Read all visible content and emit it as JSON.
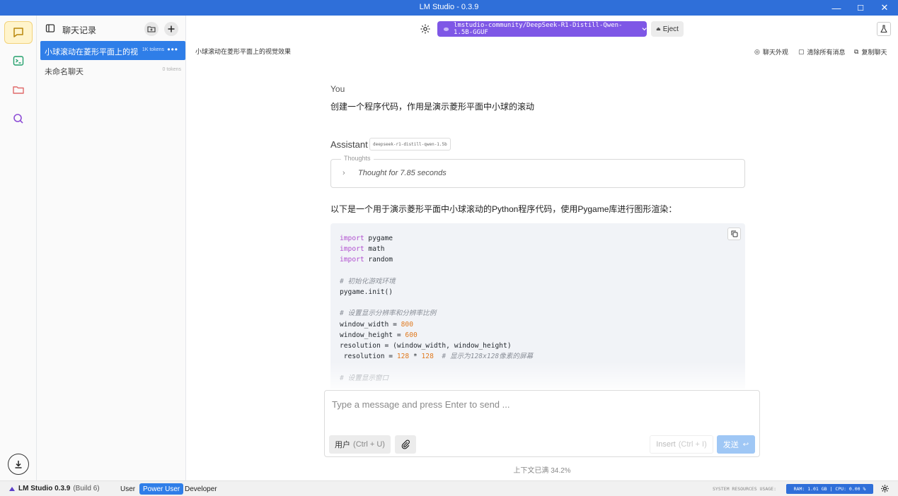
{
  "window": {
    "title": "LM Studio - 0.3.9",
    "minimize": "—",
    "maximize": "☐",
    "close": "✕"
  },
  "rail": {
    "items": [
      "chat-icon",
      "terminal-icon",
      "folder-icon",
      "search-icon"
    ],
    "download": "download-icon"
  },
  "sidebar": {
    "title": "聊天记录",
    "chats": [
      {
        "name": "小球滚动在菱形平面上的视...",
        "tokens": "1K tokens",
        "active": true
      },
      {
        "name": "未命名聊天",
        "tokens": "0 tokens",
        "active": false
      }
    ],
    "more": "•••"
  },
  "topbar": {
    "model": "lmstudio-community/DeepSeek-R1-Distill-Qwen-1.5B-GGUF",
    "eject": "Eject"
  },
  "subbar": {
    "chat_title": "小球滚动在菱形平面上的视觉效果",
    "appearance": "聊天外观",
    "clear": "清除所有消息",
    "copy": "复制聊天"
  },
  "messages": {
    "user_role": "You",
    "user_text": "创建一个程序代码，作用是演示菱形平面中小球的滚动",
    "assistant_role": "Assistant",
    "model_tag": "deepseek-r1-distill-qwen-1.5b",
    "thoughts_label": "Thoughts",
    "thoughts_text": "Thought for 7.85 seconds",
    "assistant_text": "以下是一个用于演示菱形平面中小球滚动的Python程序代码，使用Pygame库进行图形渲染："
  },
  "code": {
    "lines": [
      [
        [
          "kw",
          "import"
        ],
        [
          "t",
          " pygame"
        ]
      ],
      [
        [
          "kw",
          "import"
        ],
        [
          "t",
          " math"
        ]
      ],
      [
        [
          "kw",
          "import"
        ],
        [
          "t",
          " random"
        ]
      ],
      [
        [
          "t",
          ""
        ]
      ],
      [
        [
          "cmt",
          "# 初始化游戏环境"
        ]
      ],
      [
        [
          "t",
          "pygame.init()"
        ]
      ],
      [
        [
          "t",
          ""
        ]
      ],
      [
        [
          "cmt",
          "# 设置显示分辨率和分辨率比例"
        ]
      ],
      [
        [
          "t",
          "window_width = "
        ],
        [
          "num",
          "800"
        ]
      ],
      [
        [
          "t",
          "window_height = "
        ],
        [
          "num",
          "600"
        ]
      ],
      [
        [
          "t",
          "resolution = (window_width, window_height)"
        ]
      ],
      [
        [
          "t",
          " resolution = "
        ],
        [
          "num",
          "128"
        ],
        [
          "t",
          " * "
        ],
        [
          "num",
          "128"
        ],
        [
          "t",
          "  "
        ],
        [
          "cmt",
          "# 显示为128x128像素的屏幕"
        ]
      ],
      [
        [
          "t",
          ""
        ]
      ],
      [
        [
          "cmt",
          "# 设置显示窗口"
        ]
      ]
    ]
  },
  "composer": {
    "placeholder": "Type a message and press Enter to send ...",
    "role_label": "用户",
    "role_shortcut": "(Ctrl + U)",
    "insert_label": "Insert",
    "insert_shortcut": "(Ctrl + I)",
    "send_label": "发送",
    "send_symbol": "↩",
    "context": "上下文已满 34.2%"
  },
  "status": {
    "app": "LM Studio 0.3.9",
    "build": "(Build 6)",
    "modes": [
      "User",
      "Power User",
      "Developer"
    ],
    "active_mode": "Power User",
    "sys_label": "SYSTEM RESOURCES USAGE:",
    "sys_values": "RAM: 1.01 GB  |  CPU: 0.00 %"
  },
  "colors": {
    "titlebar": "#2f6fd9",
    "accent": "#2f7ee8",
    "model_pill": "#7e57e6",
    "send_disabled": "#9fc7f5"
  }
}
